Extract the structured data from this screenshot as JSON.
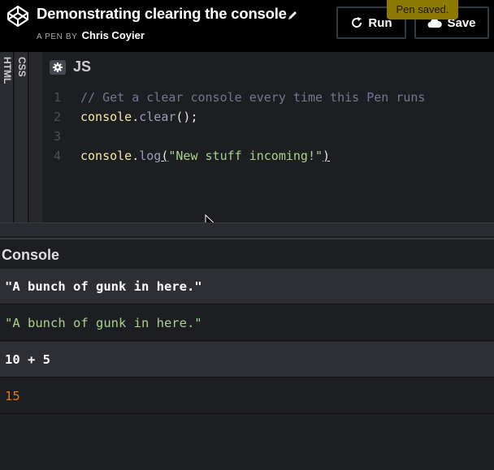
{
  "header": {
    "pen_title": "Demonstrating clearing the console",
    "byline_prefix": "A PEN BY",
    "author": "Chris Coyier",
    "run_label": "Run",
    "save_label": "Save",
    "toast": "Pen saved."
  },
  "tabs": {
    "html": "HTML",
    "css": "CSS",
    "js": "JS"
  },
  "code_lines": [
    {
      "num": "1",
      "comment": "// Get a clear console every time this Pen runs"
    },
    {
      "num": "2",
      "obj": "console",
      "dot": ".",
      "fn": "clear",
      "tail": "();"
    },
    {
      "num": "3"
    },
    {
      "num": "4",
      "obj": "console",
      "dot": ".",
      "fn": "log",
      "open": "(",
      "str": "\"New stuff incoming!\"",
      "close": ")"
    }
  ],
  "console": {
    "title": "Console",
    "rows": [
      {
        "kind": "input",
        "text": "\"A bunch of gunk in here.\""
      },
      {
        "kind": "output-string",
        "text": "\"A bunch of gunk in here.\""
      },
      {
        "kind": "input",
        "text": "10 + 5"
      },
      {
        "kind": "output-number",
        "text": "15"
      }
    ]
  },
  "colors": {
    "header_bg": "#000000",
    "editor_bg": "#1d1e22",
    "toast_bg": "#8d7a04",
    "string": "#a8d08d",
    "number": "#e0791f"
  }
}
